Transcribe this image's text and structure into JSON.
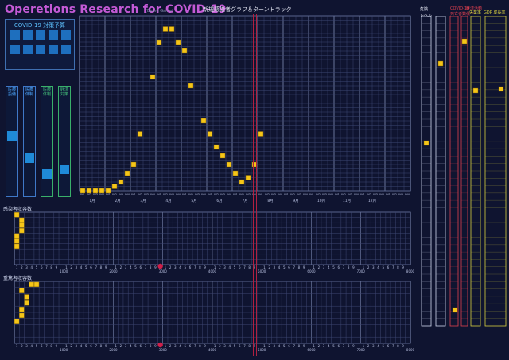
{
  "header": {
    "title": "Operetions Research for COVID-19",
    "subtitle": "(Board Game)",
    "chart_title": "新規感染者グラフ＆ターントラック"
  },
  "panel": {
    "title": "COVID-19 対策予算",
    "columns": [
      {
        "label": "医療\n設備",
        "color": "#3f78c8",
        "level": 0.55
      },
      {
        "label": "医療\n体制",
        "color": "#3f78c8",
        "level": 0.35
      },
      {
        "label": "医療\n体制",
        "color": "#39b06a",
        "level": 0.2
      },
      {
        "label": "経済\n対策",
        "color": "#39b06a",
        "level": 0.25
      }
    ]
  },
  "track1": {
    "label": "感染者収容数"
  },
  "track2": {
    "label": "重篤者収容数"
  },
  "right": {
    "col1": "危険\nレベル",
    "col2": "COVID-19\n死亡者数",
    "col3": "経済活動\n低下",
    "col4": "失業率",
    "col5": "GDP 成長率"
  },
  "chart_data": {
    "type": "line",
    "title": "新規感染者グラフ＆ターントラック",
    "months": [
      "1月",
      "2月",
      "3月",
      "4月",
      "5月",
      "6月",
      "7月",
      "8月",
      "9月",
      "10月",
      "11月",
      "12月"
    ],
    "weeks": [
      "W1",
      "W2",
      "W3",
      "W4"
    ],
    "ylim": [
      0,
      2000
    ],
    "markers": [
      [
        1,
        0
      ],
      [
        2,
        0
      ],
      [
        3,
        0
      ],
      [
        4,
        0
      ],
      [
        5,
        0
      ],
      [
        6,
        50
      ],
      [
        7,
        100
      ],
      [
        8,
        200
      ],
      [
        9,
        300
      ],
      [
        10,
        650
      ],
      [
        12,
        1300
      ],
      [
        13,
        1700
      ],
      [
        14,
        1850
      ],
      [
        15,
        1850
      ],
      [
        16,
        1700
      ],
      [
        17,
        1600
      ],
      [
        18,
        1200
      ],
      [
        20,
        800
      ],
      [
        21,
        650
      ],
      [
        22,
        500
      ],
      [
        23,
        400
      ],
      [
        24,
        300
      ],
      [
        25,
        200
      ],
      [
        26,
        100
      ],
      [
        27,
        150
      ],
      [
        28,
        300
      ],
      [
        29,
        650
      ]
    ],
    "turn_marker": 28
  }
}
